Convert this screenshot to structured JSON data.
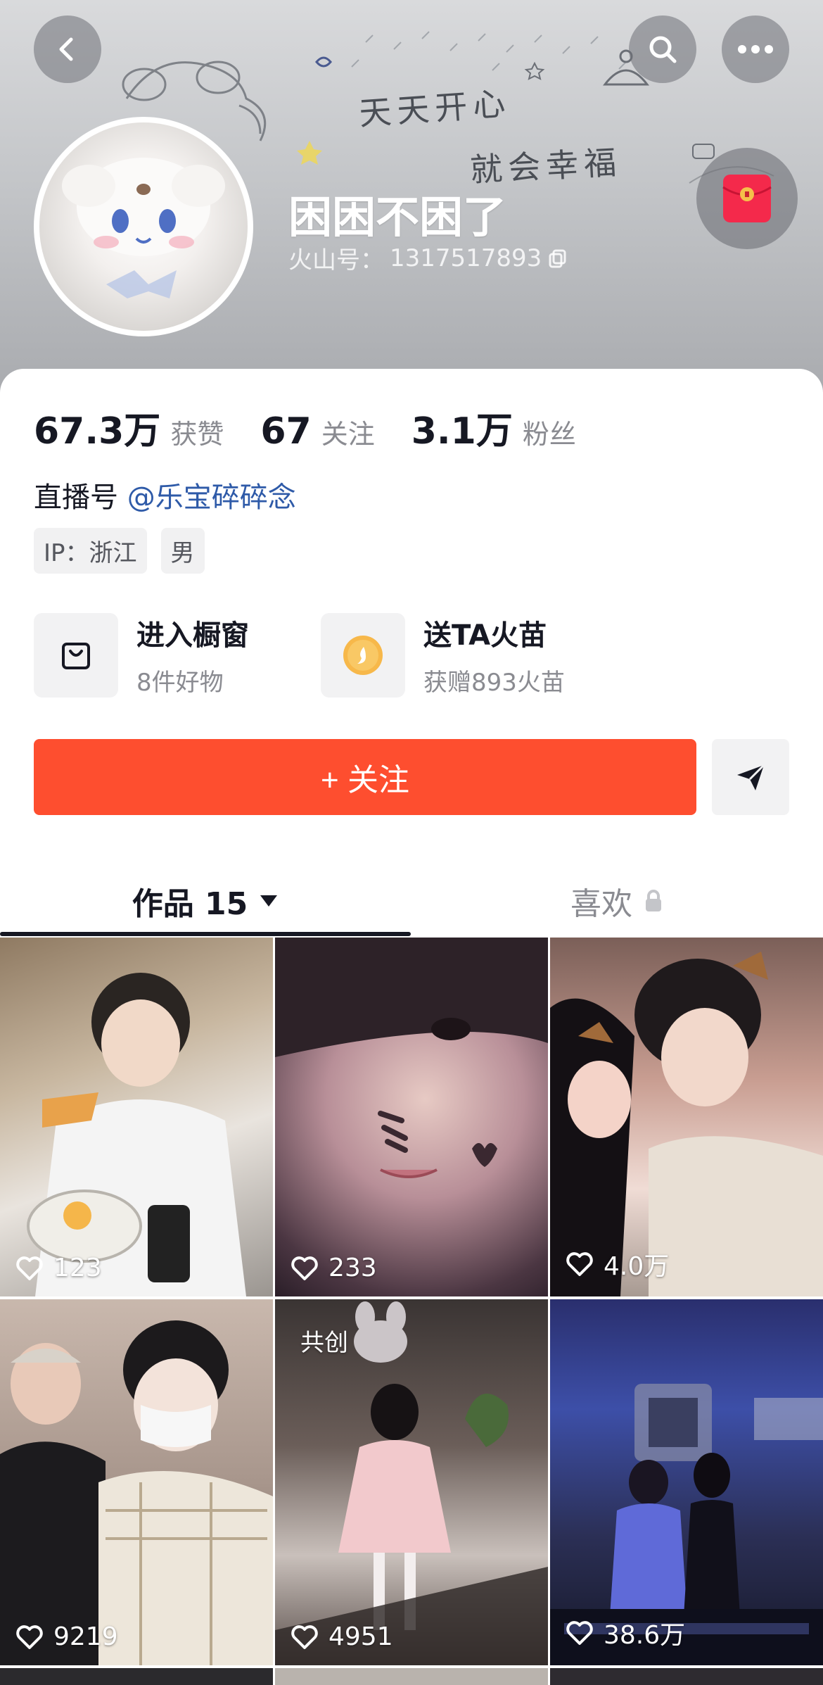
{
  "header": {
    "username": "困困不困了",
    "uid_label": "火山号：",
    "uid_value": "1317517893",
    "handwriting_line1": "天天开心",
    "handwriting_line2": "就会幸福"
  },
  "stats": [
    {
      "value": "67.3万",
      "label": "获赞"
    },
    {
      "value": "67",
      "label": "关注"
    },
    {
      "value": "3.1万",
      "label": "粉丝"
    }
  ],
  "live": {
    "prefix": "直播号",
    "link": "@乐宝碎碎念"
  },
  "tags": [
    "IP：浙江",
    "男"
  ],
  "features": {
    "shop": {
      "title": "进入橱窗",
      "sub": "8件好物",
      "icon": "shopping-bag-icon"
    },
    "gift": {
      "title": "送TA火苗",
      "sub": "获赠893火苗",
      "icon": "flame-coin-icon"
    }
  },
  "actions": {
    "follow_label": "+ 关注",
    "share_icon": "send-icon"
  },
  "tabs": {
    "works_label": "作品 15",
    "likes_label": "喜欢"
  },
  "videos": [
    {
      "likes": "123",
      "badge": ""
    },
    {
      "likes": "233",
      "badge": ""
    },
    {
      "likes": "4.0万",
      "badge": ""
    },
    {
      "likes": "9219",
      "badge": ""
    },
    {
      "likes": "4951",
      "badge": "共创"
    },
    {
      "likes": "38.6万",
      "badge": ""
    }
  ],
  "colors": {
    "accent": "#fe4e2f",
    "link": "#2e5aa8",
    "text": "#161823",
    "muted": "#8a8b91"
  }
}
